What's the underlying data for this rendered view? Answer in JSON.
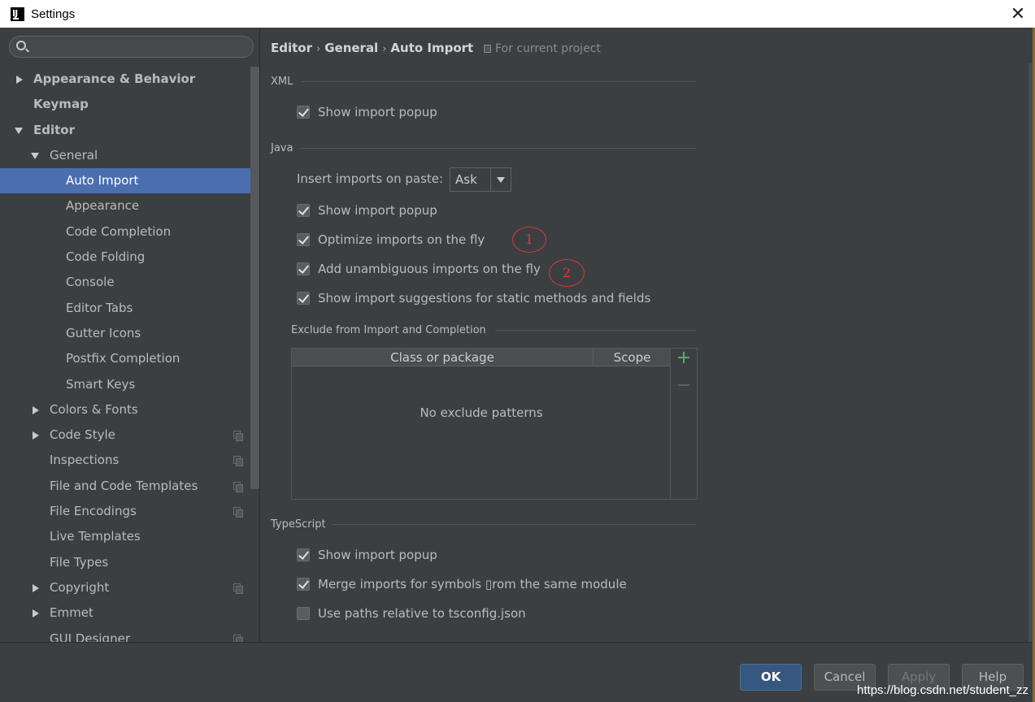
{
  "window": {
    "title": "Settings"
  },
  "search": {
    "placeholder": ""
  },
  "sidebar": {
    "items": [
      {
        "label": "Appearance & Behavior",
        "level": 0,
        "arrow": "right",
        "bold": true,
        "proj": false,
        "selected": false
      },
      {
        "label": "Keymap",
        "level": 0,
        "arrow": "none",
        "bold": true,
        "proj": false,
        "selected": false
      },
      {
        "label": "Editor",
        "level": 0,
        "arrow": "down",
        "bold": true,
        "proj": false,
        "selected": false
      },
      {
        "label": "General",
        "level": 1,
        "arrow": "down",
        "bold": false,
        "proj": false,
        "selected": false
      },
      {
        "label": "Auto Import",
        "level": 2,
        "arrow": "none",
        "bold": false,
        "proj": false,
        "selected": true
      },
      {
        "label": "Appearance",
        "level": 2,
        "arrow": "none",
        "bold": false,
        "proj": false,
        "selected": false
      },
      {
        "label": "Code Completion",
        "level": 2,
        "arrow": "none",
        "bold": false,
        "proj": false,
        "selected": false
      },
      {
        "label": "Code Folding",
        "level": 2,
        "arrow": "none",
        "bold": false,
        "proj": false,
        "selected": false
      },
      {
        "label": "Console",
        "level": 2,
        "arrow": "none",
        "bold": false,
        "proj": false,
        "selected": false
      },
      {
        "label": "Editor Tabs",
        "level": 2,
        "arrow": "none",
        "bold": false,
        "proj": false,
        "selected": false
      },
      {
        "label": "Gutter Icons",
        "level": 2,
        "arrow": "none",
        "bold": false,
        "proj": false,
        "selected": false
      },
      {
        "label": "Postfix Completion",
        "level": 2,
        "arrow": "none",
        "bold": false,
        "proj": false,
        "selected": false
      },
      {
        "label": "Smart Keys",
        "level": 2,
        "arrow": "none",
        "bold": false,
        "proj": false,
        "selected": false
      },
      {
        "label": "Colors & Fonts",
        "level": 1,
        "arrow": "right",
        "bold": false,
        "proj": false,
        "selected": false
      },
      {
        "label": "Code Style",
        "level": 1,
        "arrow": "right",
        "bold": false,
        "proj": true,
        "selected": false
      },
      {
        "label": "Inspections",
        "level": 1,
        "arrow": "none",
        "bold": false,
        "proj": true,
        "selected": false
      },
      {
        "label": "File and Code Templates",
        "level": 1,
        "arrow": "none",
        "bold": false,
        "proj": true,
        "selected": false
      },
      {
        "label": "File Encodings",
        "level": 1,
        "arrow": "none",
        "bold": false,
        "proj": true,
        "selected": false
      },
      {
        "label": "Live Templates",
        "level": 1,
        "arrow": "none",
        "bold": false,
        "proj": false,
        "selected": false
      },
      {
        "label": "File Types",
        "level": 1,
        "arrow": "none",
        "bold": false,
        "proj": false,
        "selected": false
      },
      {
        "label": "Copyright",
        "level": 1,
        "arrow": "right",
        "bold": false,
        "proj": true,
        "selected": false
      },
      {
        "label": "Emmet",
        "level": 1,
        "arrow": "right",
        "bold": false,
        "proj": false,
        "selected": false
      },
      {
        "label": "GUI Designer",
        "level": 1,
        "arrow": "none",
        "bold": false,
        "proj": true,
        "selected": false
      }
    ]
  },
  "breadcrumb": {
    "parts": [
      "Editor",
      "General",
      "Auto Import"
    ],
    "separator": "›",
    "scope": "For current project"
  },
  "xml": {
    "title": "XML",
    "show_popup": {
      "label": "Show import popup",
      "checked": true
    }
  },
  "java": {
    "title": "Java",
    "insert_label": "Insert imports on paste:",
    "insert_value": "Ask",
    "show_popup": {
      "label": "Show import popup",
      "checked": true
    },
    "optimize": {
      "label": "Optimize imports on the fly",
      "checked": true
    },
    "add_unambiguous": {
      "label": "Add unambiguous imports on the fly",
      "checked": true
    },
    "static_suggestions": {
      "label": "Show import suggestions for static methods and fields",
      "checked": true
    }
  },
  "annotations": [
    "1",
    "2"
  ],
  "exclude": {
    "title": "Exclude from Import and Completion",
    "col_class": "Class or package",
    "col_scope": "Scope",
    "empty": "No exclude patterns"
  },
  "typescript": {
    "title": "TypeScript",
    "show_popup": {
      "label": "Show import popup",
      "checked": true
    },
    "merge": {
      "label": "Merge imports for symbols ▯rom the same module",
      "checked": true
    },
    "paths": {
      "label": "Use paths relative to tsconfig.json",
      "checked": false
    }
  },
  "buttons": {
    "ok": "OK",
    "cancel": "Cancel",
    "apply": "Apply",
    "help": "Help"
  },
  "watermark": "https://blog.csdn.net/student_zz",
  "colors": {
    "selection": "#4b6eaf",
    "ok_button": "#365880",
    "annotation": "#d63b36",
    "add_icon": "#59a869"
  }
}
